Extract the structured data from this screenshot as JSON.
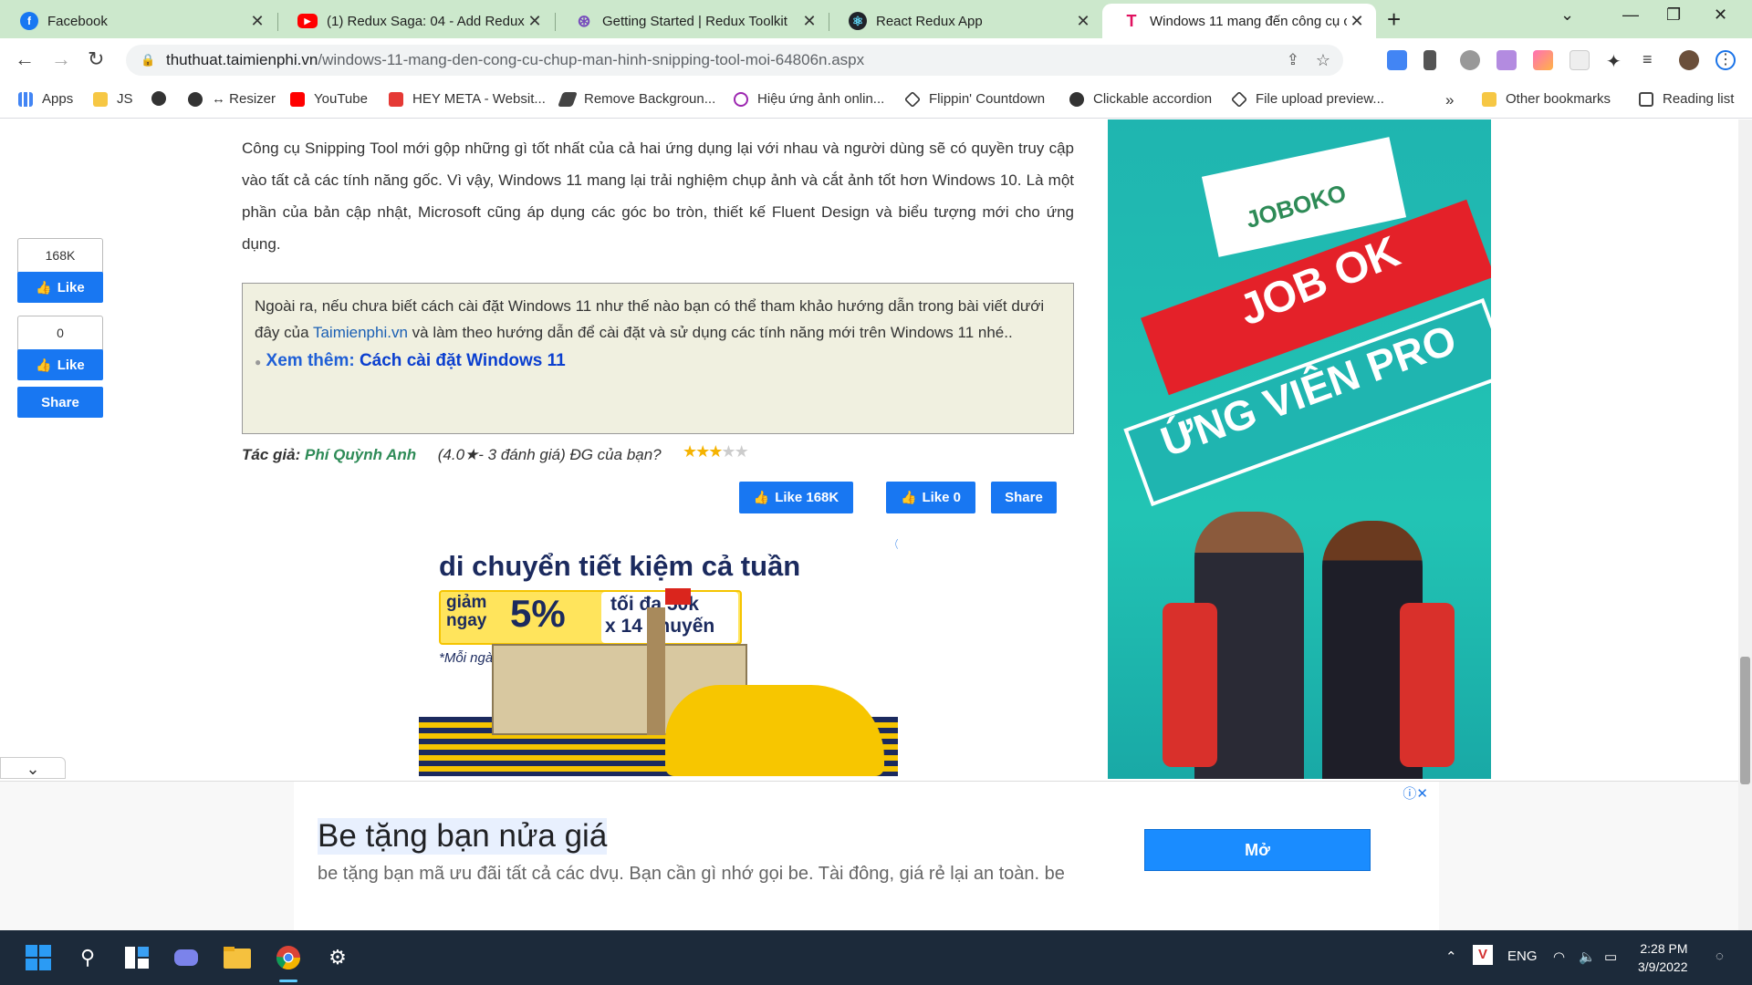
{
  "tabs": [
    {
      "title": "Facebook",
      "icon": "facebook-icon",
      "color": "#1877f2"
    },
    {
      "title": "(1) Redux Saga: 04 - Add Redux S",
      "icon": "youtube-icon",
      "color": "#ff0000"
    },
    {
      "title": "Getting Started | Redux Toolkit",
      "icon": "redux-toolkit-icon",
      "color": "#764abc"
    },
    {
      "title": "React Redux App",
      "icon": "react-icon",
      "color": "#20232a"
    },
    {
      "title": "Windows 11 mang đến công cụ c",
      "icon": "taimienphi-icon",
      "color": "#e0115f"
    }
  ],
  "address_bar": {
    "domain": "thuthuat.taimienphi.vn",
    "path": "/windows-11-mang-den-cong-cu-chup-man-hinh-snipping-tool-moi-64806n.aspx"
  },
  "bookmarks": [
    {
      "label": "Apps",
      "icon": "apps-grid-icon"
    },
    {
      "label": "JS",
      "icon": "folder-icon"
    },
    {
      "label": "",
      "icon": "globe-icon"
    },
    {
      "label": "↔ Resizer",
      "icon": "globe-icon"
    },
    {
      "label": "YouTube",
      "icon": "youtube-icon"
    },
    {
      "label": "HEY META - Websit...",
      "icon": "hey-meta-icon"
    },
    {
      "label": "Remove Backgroun...",
      "icon": "removebg-icon"
    },
    {
      "label": "Hiệu ứng ảnh onlin...",
      "icon": "c-logo-icon"
    },
    {
      "label": "Flippin' Countdown",
      "icon": "codepen-icon"
    },
    {
      "label": "Clickable accordion",
      "icon": "globe-icon"
    },
    {
      "label": "File upload preview...",
      "icon": "codepen-icon"
    }
  ],
  "bookmarks_right": {
    "other": "Other bookmarks",
    "reading": "Reading list",
    "more": "»"
  },
  "article": {
    "paragraph": "Công cụ Snipping Tool mới gộp những gì tốt nhất của cả hai ứng dụng lại với nhau và người dùng sẽ có quyền truy cập vào tất cả các tính năng gốc. Vì vậy, Windows 11 mang lại trải nghiệm chụp ảnh và cắt ảnh tốt hơn Windows 10. Là một phần của bản cập nhật, Microsoft cũng áp dụng các góc bo tròn, thiết kế Fluent Design và biểu tượng mới cho ứng dụng.",
    "note_before": "Ngoài ra, nếu chưa biết cách cài đặt Windows 11 như thế nào bạn có thể tham khảo hướng dẫn trong bài viết dưới đây của ",
    "note_link": "Taimienphi.vn",
    "note_after": " và làm theo hướng dẫn để cài đặt và sử dụng các tính năng mới trên Windows 11 nhé..",
    "see_more_label": "Xem thêm:",
    "see_more_link": "Cách cài đặt Windows 11"
  },
  "author": {
    "label": "Tác giả:",
    "name": "Phí Quỳnh Anh",
    "rating_text": "(4.0★- 3 đánh giá)  ĐG của bạn?",
    "stars": 3,
    "max_stars": 5
  },
  "share_inline": {
    "like1": "Like 168K",
    "like2": "Like 0",
    "share": "Share"
  },
  "share_sidebar": {
    "count1": "168K",
    "like": "Like",
    "count2": "0",
    "share": "Share"
  },
  "ad_banner": {
    "headline": "di chuyển tiết kiệm cả tuần",
    "discount_label": "giảm ngay",
    "discount": "5%",
    "max_line1": "tối đa 50k",
    "max_line2": "x 14 chuyến",
    "footnote": "*Mỗi ngày 2 chuyến"
  },
  "right_ad": {
    "brand": "JOBOKO",
    "line1": "JOB OK",
    "line2": "ỨNG VIÊN PRO"
  },
  "bottom_ad": {
    "title": "Be tặng bạn nửa giá",
    "description": "be tặng bạn mã ưu đãi tất cả các dvụ. Bạn cần gì nhớ gọi be. Tài đông, giá rẻ lại an toàn. be",
    "button": "Mở"
  },
  "taskbar": {
    "language": "ENG",
    "time": "2:28 PM",
    "date": "3/9/2022"
  },
  "colors": {
    "facebook_blue": "#1877f2",
    "tab_strip": "#cce8cc",
    "taskbar": "#1c2a3a"
  }
}
